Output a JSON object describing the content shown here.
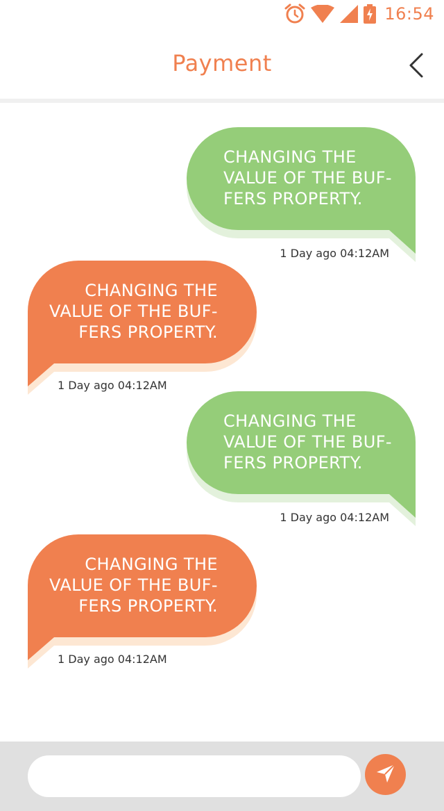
{
  "status_bar": {
    "time": "16:54",
    "icons": [
      "alarm-icon",
      "wifi-icon",
      "signal-icon",
      "battery-charging-icon"
    ],
    "color": "#f0804f"
  },
  "header": {
    "title": "Payment",
    "back_icon": "chevron-left-icon"
  },
  "messages": [
    {
      "direction": "sent",
      "text": "CHANGING THE VALUE OF THE BUF-FERS PROPERTY.",
      "lines": [
        "CHANGING THE",
        "VALUE OF THE BUF-",
        "FERS PROPERTY."
      ],
      "time": "1 Day ago 04:12AM"
    },
    {
      "direction": "received",
      "text": "CHANGING THE VALUE OF THE BUF-FERS PROPERTY.",
      "lines": [
        "CHANGING THE",
        "VALUE OF THE BUF-",
        "FERS PROPERTY."
      ],
      "time": "1 Day ago 04:12AM"
    },
    {
      "direction": "sent",
      "text": "CHANGING THE VALUE OF THE BUF-FERS PROPERTY.",
      "lines": [
        "CHANGING THE",
        "VALUE OF THE BUF-",
        "FERS PROPERTY."
      ],
      "time": "1 Day ago 04:12AM"
    },
    {
      "direction": "received",
      "text": "CHANGING THE VALUE OF THE BUF-FERS PROPERTY.",
      "lines": [
        "CHANGING THE",
        "VALUE OF THE BUF-",
        "FERS PROPERTY."
      ],
      "time": "1 Day ago 04:12AM"
    }
  ],
  "composer": {
    "input_value": "",
    "input_placeholder": "",
    "send_icon": "send-icon"
  },
  "colors": {
    "accent": "#f0804f",
    "sent_bubble": "#95cd79",
    "sent_shadow": "#e3f1dc",
    "received_bubble": "#f0804f",
    "received_shadow": "#fde7d3",
    "composer_bg": "#e0e0e0"
  }
}
